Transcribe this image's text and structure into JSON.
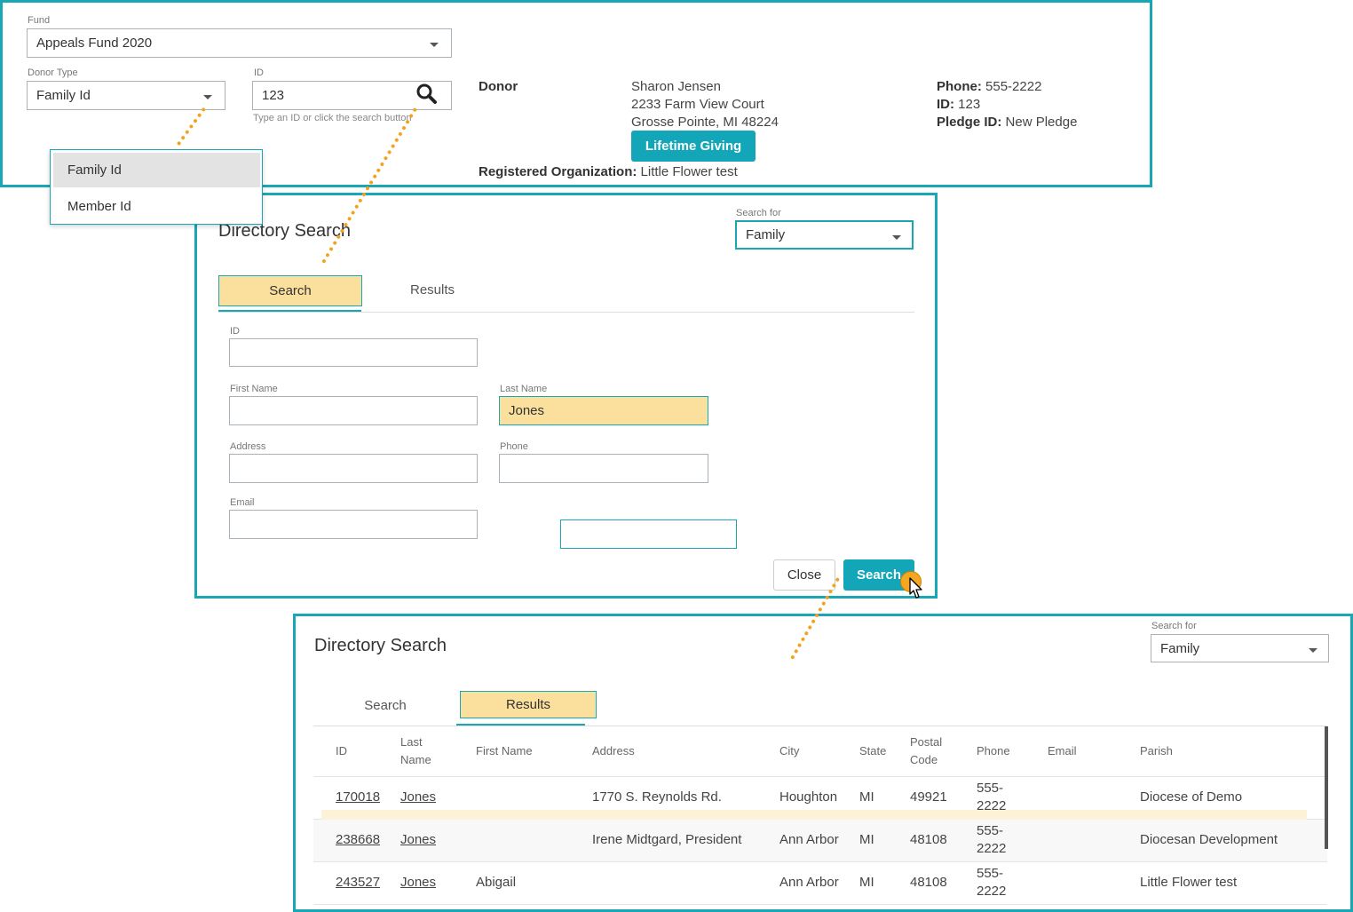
{
  "top": {
    "fund_label": "Fund",
    "fund_value": "Appeals Fund 2020",
    "donor_type_label": "Donor Type",
    "donor_type_value": "Family Id",
    "id_label": "ID",
    "id_value": "123",
    "id_hint": "Type an ID or click the search button",
    "donor_heading": "Donor",
    "donor_name": "Sharon Jensen",
    "donor_addr1": "2233 Farm View Court",
    "donor_addr2": "Grosse Pointe, MI 48224",
    "lifetime_button": "Lifetime Giving",
    "reg_org_label": "Registered Organization:",
    "reg_org_value": "Little Flower test",
    "phone_label": "Phone:",
    "phone_value": "555-2222",
    "id2_label": "ID:",
    "id2_value": "123",
    "pledge_label": "Pledge ID:",
    "pledge_value": "New Pledge",
    "dropdown_options": [
      "Family Id",
      "Member Id"
    ]
  },
  "search_dialog": {
    "title": "Directory Search",
    "search_for_label": "Search for",
    "search_for_value": "Family",
    "tabs": [
      "Search",
      "Results"
    ],
    "id_label": "ID",
    "first_name_label": "First Name",
    "last_name_label": "Last Name",
    "last_name_value": "Jones",
    "address_label": "Address",
    "phone_label": "Phone",
    "email_label": "Email",
    "close_button": "Close",
    "search_button": "Search"
  },
  "results_dialog": {
    "title": "Directory Search",
    "search_for_label": "Search for",
    "search_for_value": "Family",
    "tabs": [
      "Search",
      "Results"
    ],
    "columns": [
      "ID",
      "Last Name",
      "First Name",
      "Address",
      "City",
      "State",
      "Postal Code",
      "Phone",
      "Email",
      "Parish"
    ],
    "rows": [
      {
        "id": "170018",
        "last": "Jones",
        "first": "",
        "address": "1770 S. Reynolds Rd.",
        "city": "Houghton",
        "state": "MI",
        "postal": "49921",
        "phone": "555-2222",
        "email": "",
        "parish": "Diocese of Demo"
      },
      {
        "id": "238668",
        "last": "Jones",
        "first": "",
        "address": "Irene Midtgard, President",
        "city": "Ann Arbor",
        "state": "MI",
        "postal": "48108",
        "phone": "555-2222",
        "email": "",
        "parish": "Diocesan Development"
      },
      {
        "id": "243527",
        "last": "Jones",
        "first": "Abigail",
        "address": "",
        "city": "Ann Arbor",
        "state": "MI",
        "postal": "48108",
        "phone": "555-2222",
        "email": "",
        "parish": "Little Flower test"
      }
    ]
  },
  "colors": {
    "accent": "#13a6b8",
    "highlight": "#fbdf9c",
    "callout": "#f2a31c"
  }
}
